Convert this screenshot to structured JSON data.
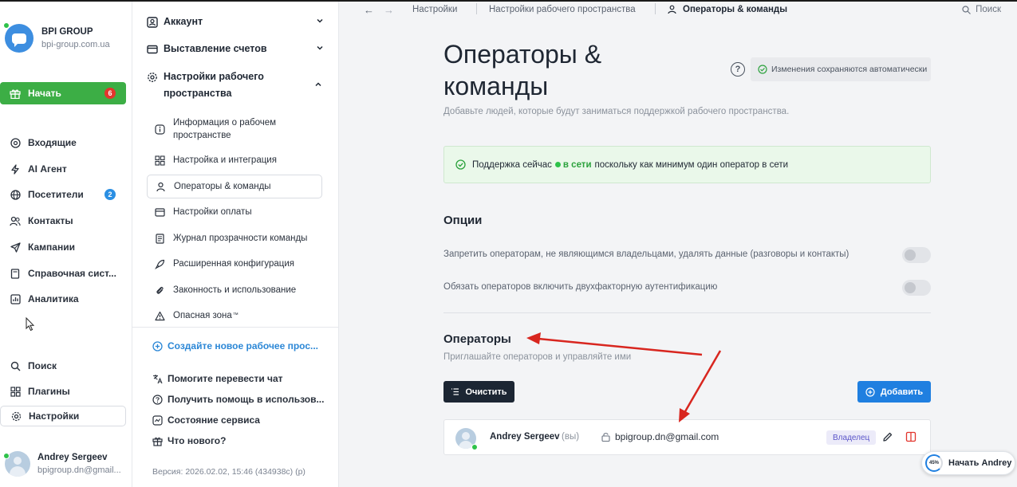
{
  "workspace": {
    "name": "BPI GROUP",
    "domain": "bpi-group.com.ua"
  },
  "sidebar": {
    "start": {
      "label": "Начать",
      "badge": "6"
    },
    "items": [
      {
        "label": "Входящие"
      },
      {
        "label": "AI Агент"
      },
      {
        "label": "Посетители",
        "badge": "2"
      },
      {
        "label": "Контакты"
      },
      {
        "label": "Кампании"
      },
      {
        "label": "Справочная сист..."
      },
      {
        "label": "Аналитика"
      }
    ],
    "bottom_items": [
      {
        "label": "Поиск"
      },
      {
        "label": "Плагины"
      },
      {
        "label": "Настройки"
      }
    ],
    "user": {
      "name": "Andrey Sergeev",
      "email": "bpigroup.dn@gmail..."
    }
  },
  "settings_panel": {
    "sections": [
      {
        "label": "Аккаунт"
      },
      {
        "label": "Выставление счетов"
      },
      {
        "label": "Настройки рабочего пространства"
      }
    ],
    "workspace_items": [
      {
        "label": "Информация о рабочем пространстве"
      },
      {
        "label": "Настройка и интеграция"
      },
      {
        "label": "Операторы & команды"
      },
      {
        "label": "Настройки оплаты"
      },
      {
        "label": "Журнал прозрачности команды"
      },
      {
        "label": "Расширенная конфигурация"
      },
      {
        "label": "Законность и использование"
      },
      {
        "label": "Опасная зона"
      }
    ],
    "create_workspace": "Создайте новое рабочее прос...",
    "help_items": [
      {
        "label": "Помогите перевести чат"
      },
      {
        "label": "Получить помощь в использов..."
      },
      {
        "label": "Состояние сервиса"
      },
      {
        "label": "Что нового?"
      }
    ],
    "version": "Версия: 2026.02.02, 15:46 (434938c) (p)"
  },
  "topbar": {
    "breadcrumbs": [
      "Настройки",
      "Настройки рабочего пространства",
      "Операторы & команды"
    ],
    "search": "Поиск"
  },
  "page": {
    "title": "Операторы & команды",
    "autosave": "Изменения сохраняются автоматически",
    "description": "Добавьте людей, которые будут заниматься поддержкой рабочего пространства.",
    "status": {
      "prefix": "Поддержка сейчас",
      "online": "в сети",
      "suffix": "поскольку как минимум один оператор в сети"
    },
    "options": {
      "title": "Опции",
      "items": [
        {
          "label": "Запретить операторам, не являющимся владельцами, удалять данные (разговоры и контакты)",
          "enabled": false
        },
        {
          "label": "Обязать операторов включить двухфакторную аутентификацию",
          "enabled": false
        }
      ]
    },
    "operators": {
      "title": "Операторы",
      "description": "Приглашайте операторов и управляйте ими",
      "clear_button": "Очистить",
      "add_button": "Добавить",
      "list": [
        {
          "name": "Andrey Sergeev",
          "you": "(вы)",
          "email": "bpigroup.dn@gmail.com",
          "role": "Владелец"
        }
      ]
    }
  },
  "widget": {
    "progress": "45%",
    "label": "Начать Andrey"
  },
  "colors": {
    "accent_green": "#3cae45",
    "accent_blue": "#1f7fe0",
    "danger_red": "#e2352d",
    "annotation_red": "#d8261f"
  }
}
